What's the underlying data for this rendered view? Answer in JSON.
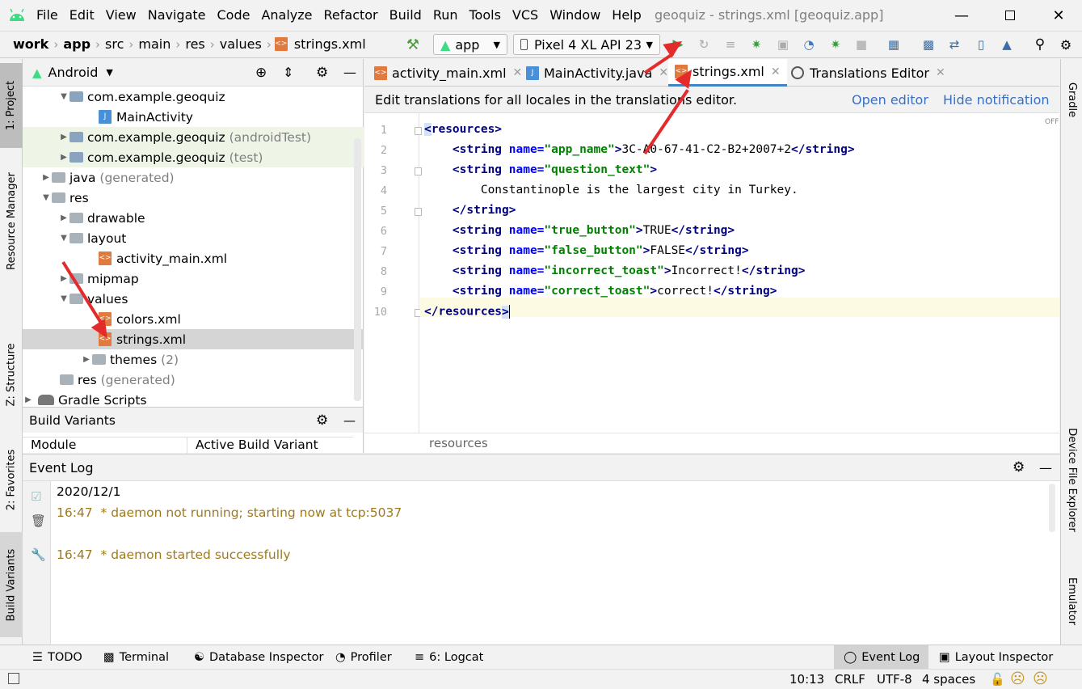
{
  "menu": {
    "items": [
      "File",
      "Edit",
      "View",
      "Navigate",
      "Code",
      "Analyze",
      "Refactor",
      "Build",
      "Run",
      "Tools",
      "VCS",
      "Window",
      "Help"
    ],
    "window_title": "geoquiz - strings.xml [geoquiz.app]"
  },
  "breadcrumb": [
    "work",
    "app",
    "src",
    "main",
    "res",
    "values",
    "strings.xml"
  ],
  "toolbar": {
    "run_config": "app",
    "device": "Pixel 4 XL API 23"
  },
  "project_panel": {
    "view_mode": "Android",
    "tree": [
      {
        "label": "com.example.geoquiz",
        "suffix": ""
      },
      {
        "label": "MainActivity",
        "suffix": ""
      },
      {
        "label": "com.example.geoquiz",
        "suffix": "(androidTest)"
      },
      {
        "label": "com.example.geoquiz",
        "suffix": "(test)"
      },
      {
        "label": "java",
        "suffix": "(generated)"
      },
      {
        "label": "res",
        "suffix": ""
      },
      {
        "label": "drawable",
        "suffix": ""
      },
      {
        "label": "layout",
        "suffix": ""
      },
      {
        "label": "activity_main.xml",
        "suffix": ""
      },
      {
        "label": "mipmap",
        "suffix": ""
      },
      {
        "label": "values",
        "suffix": ""
      },
      {
        "label": "colors.xml",
        "suffix": ""
      },
      {
        "label": "strings.xml",
        "suffix": ""
      },
      {
        "label": "themes",
        "suffix": "(2)"
      },
      {
        "label": "res",
        "suffix": "(generated)"
      },
      {
        "label": "Gradle Scripts",
        "suffix": ""
      }
    ]
  },
  "build_variants": {
    "title": "Build Variants",
    "col_module": "Module",
    "col_variant": "Active Build Variant"
  },
  "editor": {
    "tabs": [
      "activity_main.xml",
      "MainActivity.java",
      "strings.xml",
      "Translations Editor"
    ],
    "active_tab": "strings.xml",
    "notification": "Edit translations for all locales in the translations editor.",
    "open_editor": "Open editor",
    "hide_notification": "Hide notification",
    "off_badge": "OFF",
    "line_numbers": [
      "1",
      "2",
      "3",
      "4",
      "5",
      "6",
      "7",
      "8",
      "9",
      "10"
    ],
    "breadcrumb": "resources",
    "code": {
      "l2_val": "3C-A0-67-41-C2-B2+2007+2",
      "l4_text": "Constantinople is the largest city in Turkey.",
      "l6_val": "TRUE",
      "l7_val": "FALSE",
      "l8_val": "Incorrect!",
      "l9_val": "correct!"
    }
  },
  "event_log": {
    "title": "Event Log",
    "date": "2020/12/1",
    "entries": [
      {
        "time": "16:47",
        "msg": "* daemon not running; starting now at tcp:5037"
      },
      {
        "time": "16:47",
        "msg": "* daemon started successfully"
      }
    ]
  },
  "left_tabs": [
    "1: Project",
    "Resource Manager",
    "Z: Structure",
    "2: Favorites",
    "Build Variants"
  ],
  "right_tabs": [
    "Gradle",
    "Device File Explorer",
    "Emulator"
  ],
  "bottom_tools": [
    "TODO",
    "Terminal",
    "Database Inspector",
    "Profiler",
    "6: Logcat",
    "Event Log",
    "Layout Inspector"
  ],
  "status": {
    "position": "10:13",
    "line_sep": "CRLF",
    "encoding": "UTF-8",
    "indent": "4 spaces"
  }
}
